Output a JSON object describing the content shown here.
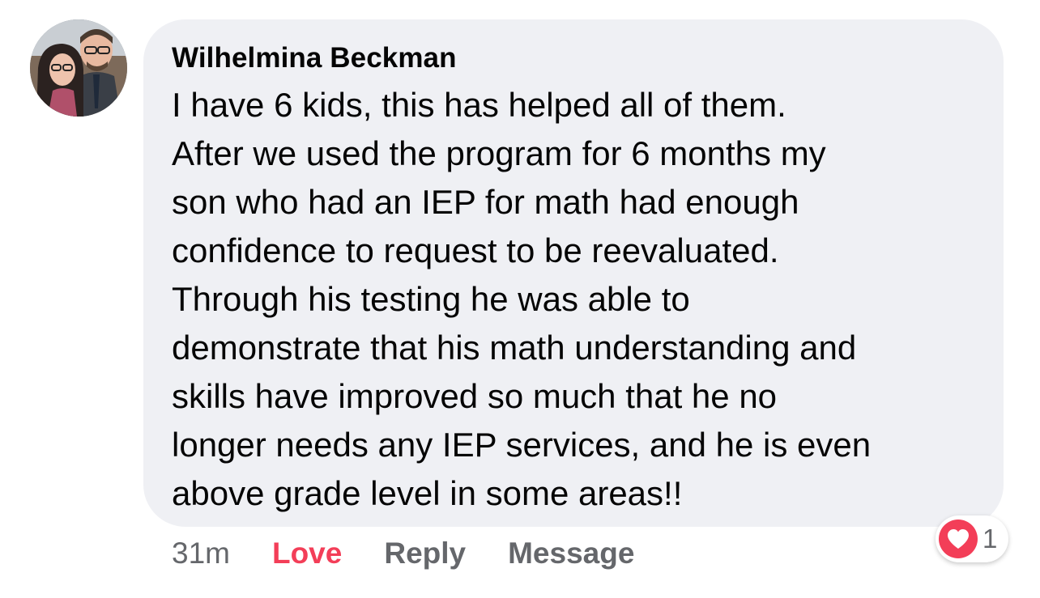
{
  "comment": {
    "author": "Wilhelmina Beckman",
    "body": "I have 6 kids, this has helped all of them.\nAfter we used the program for 6 months my\nson who had an IEP for math had enough\nconfidence to request to be reevaluated.\nThrough his testing he was able to\ndemonstrate that his math understanding and\nskills have improved so much that he no\nlonger needs any IEP services, and he is even\nabove grade level in some areas!!",
    "timestamp": "31m"
  },
  "actions": {
    "love_label": "Love",
    "reply_label": "Reply",
    "message_label": "Message"
  },
  "reactions": {
    "icon": "heart-icon",
    "count": "1"
  },
  "colors": {
    "bubble_bg": "#eff0f4",
    "love_accent": "#f33e58",
    "muted_text": "#65676b",
    "primary_text": "#050505"
  }
}
